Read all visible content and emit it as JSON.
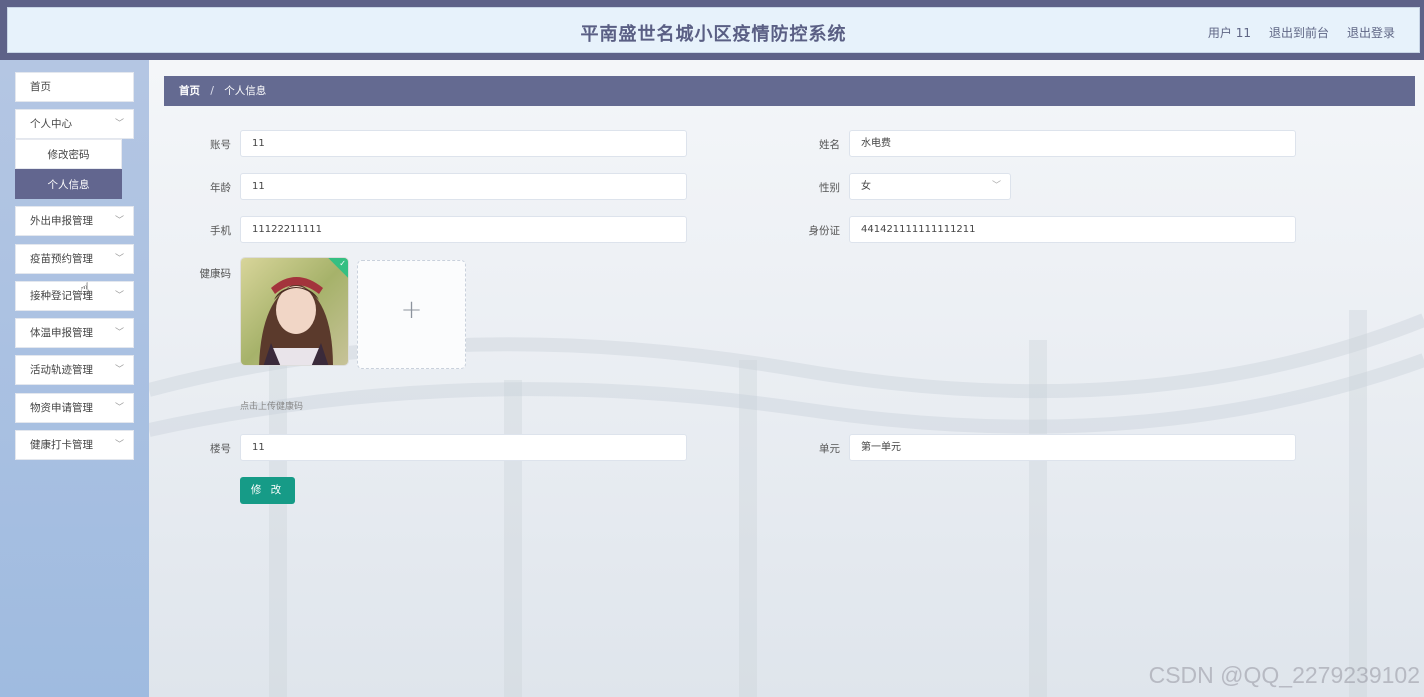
{
  "header": {
    "title": "平南盛世名城小区疫情防控系统",
    "user_label": "用户 11",
    "front_label": "退出到前台",
    "logout_label": "退出登录"
  },
  "sidebar": {
    "home": "首页",
    "personal_center": "个人中心",
    "submenu": [
      "修改密码",
      "个人信息"
    ],
    "items": [
      "外出申报管理",
      "疫苗预约管理",
      "接种登记管理",
      "体温申报管理",
      "活动轨迹管理",
      "物资申请管理",
      "健康打卡管理"
    ]
  },
  "breadcrumb": {
    "home": "首页",
    "separator": "/",
    "current": "个人信息"
  },
  "form": {
    "account_label": "账号",
    "account_value": "11",
    "name_label": "姓名",
    "name_value": "水电费",
    "age_label": "年龄",
    "age_value": "11",
    "gender_label": "性别",
    "gender_value": "女",
    "phone_label": "手机",
    "phone_value": "11122211111",
    "idcard_label": "身份证",
    "idcard_value": "441421111111111211",
    "healthcode_label": "健康码",
    "upload_tip": "点击上传健康码",
    "building_label": "楼号",
    "building_value": "11",
    "unit_label": "单元",
    "unit_value": "第一单元",
    "submit_label": "修 改"
  },
  "watermark": "CSDN @QQ_2279239102",
  "colors": {
    "accent": "#646a91",
    "submit": "#169b87",
    "success": "#35bf82"
  },
  "icons": [
    "chevron-down-icon",
    "plus-icon",
    "check-icon",
    "hand-cursor-icon"
  ]
}
